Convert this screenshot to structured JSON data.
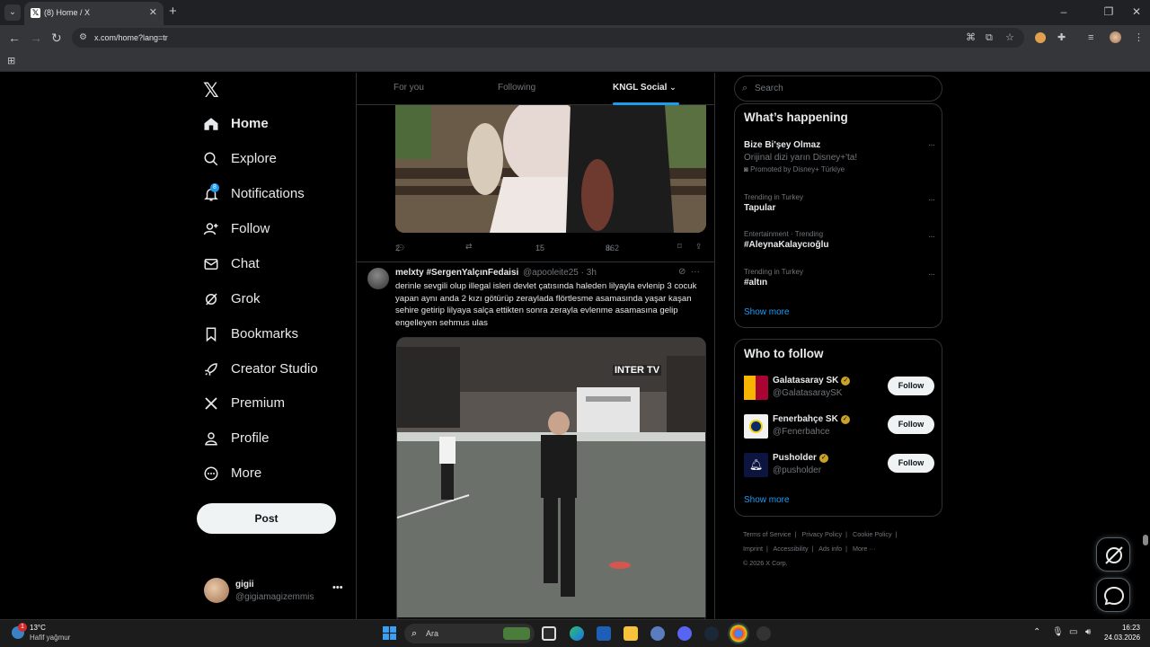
{
  "browser": {
    "tab_title": "(8) Home / X",
    "url": "x.com/home?lang=tr"
  },
  "nav": {
    "items": [
      {
        "label": "Home",
        "icon": "home-icon"
      },
      {
        "label": "Explore",
        "icon": "search-icon"
      },
      {
        "label": "Notifications",
        "icon": "bell-icon",
        "badge": "8"
      },
      {
        "label": "Follow",
        "icon": "add-user-icon"
      },
      {
        "label": "Chat",
        "icon": "mail-icon"
      },
      {
        "label": "Grok",
        "icon": "grok-icon"
      },
      {
        "label": "Bookmarks",
        "icon": "bookmark-icon"
      },
      {
        "label": "Creator Studio",
        "icon": "rocket-icon"
      },
      {
        "label": "Premium",
        "icon": "x-icon"
      },
      {
        "label": "Profile",
        "icon": "person-icon"
      },
      {
        "label": "More",
        "icon": "more-circle-icon"
      }
    ],
    "post_label": "Post",
    "account": {
      "name": "gigii",
      "handle": "@gigiamagizemmis"
    }
  },
  "timeline": {
    "tabs": [
      "For you",
      "Following",
      "KNGL Social"
    ],
    "tweet1_actions": {
      "replies": "2",
      "likes": "15",
      "views": "862"
    },
    "tweet2": {
      "name": "melxty #SergenYalçınFedaisi",
      "handle": "@apooleite25 · 3h",
      "text": "derinle sevgili olup illegal isleri devlet çatısında haleden lilyayla evlenip 3 cocuk yapan aynı anda 2 kızı götürüp zeraylada flörtlesme asamasında yaşar kaşan sehire getirip lilyaya salça ettikten sonra zerayla evlenme asamasına gelip engelleyen sehmus ulas",
      "video_watermark": "INTER TV"
    }
  },
  "sidebar": {
    "search_placeholder": "Search",
    "happening": {
      "title": "What’s happening",
      "promo": {
        "title": "Bize Bi'şey Olmaz",
        "subtitle": "Orijinal dizi yarın Disney+'ta!",
        "promoted_by": "Promoted by Disney+ Türkiye"
      },
      "trends": [
        {
          "meta": "Trending in Turkey",
          "title": "Tapular"
        },
        {
          "meta": "Entertainment · Trending",
          "title": "#AleynaKalaycıoğlu"
        },
        {
          "meta": "Trending in Turkey",
          "title": "#altın"
        }
      ],
      "show_more": "Show more"
    },
    "who_to_follow": {
      "title": "Who to follow",
      "accounts": [
        {
          "name": "Galatasaray SK",
          "handle": "@GalatasaraySK",
          "color": "#a90432"
        },
        {
          "name": "Fenerbahçe SK",
          "handle": "@Fenerbahce",
          "color": "#f2f2f2"
        },
        {
          "name": "Pusholder",
          "handle": "@pusholder",
          "color": "#0b1540"
        }
      ],
      "follow_label": "Follow",
      "show_more": "Show more"
    },
    "footer": [
      "Terms of Service",
      "|",
      "Privacy Policy",
      "|",
      "Cookie Policy",
      "|",
      "Imprint",
      "|",
      "Accessibility",
      "|",
      "Ads info",
      "|",
      "More ···",
      "© 2026 X Corp."
    ]
  },
  "taskbar": {
    "weather_badge": "1",
    "temp": "13°C",
    "weather": "Hafif yağmur",
    "search_placeholder": "Ara",
    "time": "16:23",
    "date": "24.03.2026"
  },
  "colors": {
    "accent": "#1d9bf0",
    "background": "#000000",
    "border": "#2f3336"
  }
}
